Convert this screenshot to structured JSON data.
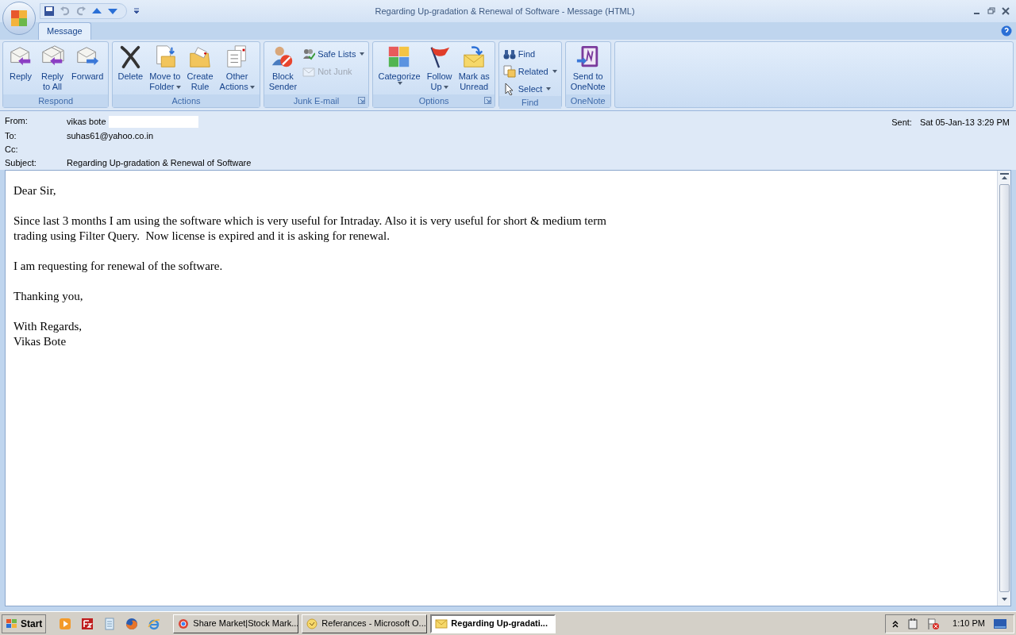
{
  "window": {
    "title": "Regarding Up-gradation & Renewal of Software - Message (HTML)"
  },
  "tabs": [
    {
      "label": "Message",
      "selected": true
    }
  ],
  "ribbon": [
    {
      "label": "Respond",
      "launcher": false,
      "buttons": [
        {
          "kind": "large",
          "lines": [
            "Reply"
          ],
          "dropdown": false,
          "disabled": false
        },
        {
          "kind": "large",
          "lines": [
            "Reply",
            "to All"
          ],
          "dropdown": false,
          "disabled": false
        },
        {
          "kind": "large",
          "lines": [
            "Forward"
          ],
          "dropdown": false,
          "disabled": false
        }
      ]
    },
    {
      "label": "Actions",
      "launcher": false,
      "buttons": [
        {
          "kind": "large",
          "lines": [
            "Delete"
          ],
          "dropdown": false,
          "disabled": false
        },
        {
          "kind": "large",
          "lines": [
            "Move to",
            "Folder"
          ],
          "dropdown": true,
          "disabled": false
        },
        {
          "kind": "large",
          "lines": [
            "Create",
            "Rule"
          ],
          "dropdown": false,
          "disabled": false
        },
        {
          "kind": "large",
          "lines": [
            "Other",
            "Actions"
          ],
          "dropdown": true,
          "disabled": false
        }
      ]
    },
    {
      "label": "Junk E-mail",
      "launcher": true,
      "buttons": [
        {
          "kind": "large",
          "lines": [
            "Block",
            "Sender"
          ],
          "dropdown": false,
          "disabled": false
        },
        {
          "kind": "small",
          "lines": [
            "Safe Lists"
          ],
          "dropdown": true,
          "disabled": false
        },
        {
          "kind": "small",
          "lines": [
            "Not Junk"
          ],
          "dropdown": false,
          "disabled": true
        }
      ]
    },
    {
      "label": "Options",
      "launcher": true,
      "buttons": [
        {
          "kind": "large",
          "lines": [
            "Categorize"
          ],
          "dropdown": true,
          "disabled": false
        },
        {
          "kind": "large",
          "lines": [
            "Follow",
            "Up"
          ],
          "dropdown": true,
          "disabled": false
        },
        {
          "kind": "large",
          "lines": [
            "Mark as",
            "Unread"
          ],
          "dropdown": false,
          "disabled": false
        }
      ]
    },
    {
      "label": "Find",
      "launcher": false,
      "buttons": [
        {
          "kind": "small",
          "lines": [
            "Find"
          ],
          "dropdown": false,
          "disabled": false
        },
        {
          "kind": "small",
          "lines": [
            "Related"
          ],
          "dropdown": true,
          "disabled": false
        },
        {
          "kind": "small",
          "lines": [
            "Select"
          ],
          "dropdown": true,
          "disabled": false
        }
      ]
    },
    {
      "label": "OneNote",
      "launcher": false,
      "buttons": [
        {
          "kind": "large",
          "lines": [
            "Send to",
            "OneNote"
          ],
          "dropdown": false,
          "disabled": false
        }
      ]
    }
  ],
  "header": {
    "from_label": "From:",
    "from": "vikas bote",
    "to_label": "To:",
    "to": "suhas61@yahoo.co.in",
    "cc_label": "Cc:",
    "subject_label": "Subject:",
    "subject": "Regarding Up-gradation & Renewal of Software",
    "sent_label": "Sent:",
    "sent": "Sat 05-Jan-13 3:29 PM"
  },
  "body": [
    [
      "Dear Sir,"
    ],
    [
      "Since last 3 months I am using the software which is very useful for Intraday. Also it is very useful for short & medium term",
      "trading using Filter Query.  Now license is expired and it is asking for renewal."
    ],
    [
      "I am requesting for renewal of the software."
    ],
    [
      "Thanking you,"
    ],
    [
      "With Regards,",
      "Vikas Bote"
    ]
  ],
  "taskbar": {
    "start": "Start",
    "tasks": [
      {
        "label": "Share Market|Stock Mark...",
        "selected": false
      },
      {
        "label": "Referances - Microsoft O...",
        "selected": false
      },
      {
        "label": "Regarding Up-gradati...",
        "selected": true
      }
    ],
    "clock": "1:10 PM"
  }
}
